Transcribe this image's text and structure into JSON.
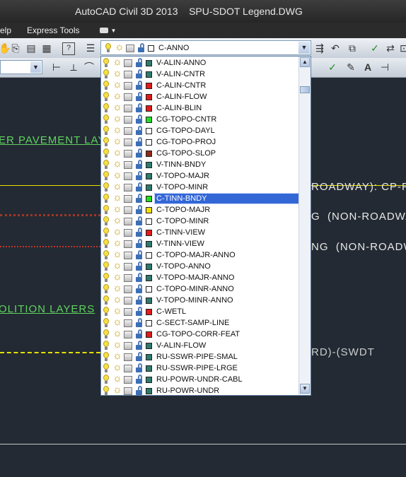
{
  "window": {
    "title": "AutoCAD Civil 3D 2013    SPU-SDOT Legend.DWG"
  },
  "menu": {
    "items": [
      "elp",
      "Express Tools"
    ]
  },
  "layer_combo": {
    "current_layer": "C-ANNO",
    "current_color": "#ffffff"
  },
  "drawing": {
    "texts": [
      {
        "text": "ER PAVEMENT LAY"
      },
      {
        "text": "ROADWAY): CP-PY"
      },
      {
        "text": "G  (NON-ROADWAY"
      },
      {
        "text": "NG  (NON-ROADW"
      },
      {
        "text": "OLITION LAYERS"
      },
      {
        "text": "RD)-(SWDT"
      }
    ]
  },
  "layers": [
    {
      "name": "V-ALIN-ANNO",
      "color": "#2e7a6e",
      "selected": false
    },
    {
      "name": "V-ALIN-CNTR",
      "color": "#2e7a6e",
      "selected": false
    },
    {
      "name": "C-ALIN-CNTR",
      "color": "#e01b1b",
      "selected": false
    },
    {
      "name": "C-ALIN-FLOW",
      "color": "#e01b1b",
      "selected": false
    },
    {
      "name": "C-ALIN-BLIN",
      "color": "#e01b1b",
      "selected": false
    },
    {
      "name": "CG-TOPO-CNTR",
      "color": "#22dd22",
      "selected": false
    },
    {
      "name": "CG-TOPO-DAYL",
      "color": "#ffffff",
      "selected": false
    },
    {
      "name": "CG-TOPO-PROJ",
      "color": "#ffffff",
      "selected": false
    },
    {
      "name": "CG-TOPO-SLOP",
      "color": "#8b2a1a",
      "selected": false
    },
    {
      "name": "V-TINN-BNDY",
      "color": "#2e7a6e",
      "selected": false
    },
    {
      "name": "V-TOPO-MAJR",
      "color": "#2e7a6e",
      "selected": false
    },
    {
      "name": "V-TOPO-MINR",
      "color": "#2e7a6e",
      "selected": false
    },
    {
      "name": "C-TINN-BNDY",
      "color": "#22dd22",
      "selected": true
    },
    {
      "name": "C-TOPO-MAJR",
      "color": "#f5e000",
      "selected": false
    },
    {
      "name": "C-TOPO-MINR",
      "color": "#ffffff",
      "selected": false
    },
    {
      "name": "C-TINN-VIEW",
      "color": "#e01b1b",
      "selected": false
    },
    {
      "name": "V-TINN-VIEW",
      "color": "#2e7a6e",
      "selected": false
    },
    {
      "name": "C-TOPO-MAJR-ANNO",
      "color": "#ffffff",
      "selected": false
    },
    {
      "name": "V-TOPO-ANNO",
      "color": "#2e7a6e",
      "selected": false
    },
    {
      "name": "V-TOPO-MAJR-ANNO",
      "color": "#2e7a6e",
      "selected": false
    },
    {
      "name": "C-TOPO-MINR-ANNO",
      "color": "#ffffff",
      "selected": false
    },
    {
      "name": "V-TOPO-MINR-ANNO",
      "color": "#2e7a6e",
      "selected": false
    },
    {
      "name": "C-WETL",
      "color": "#e01b1b",
      "selected": false
    },
    {
      "name": "C-SECT-SAMP-LINE",
      "color": "#ffffff",
      "selected": false
    },
    {
      "name": "CG-TOPO-CORR-FEAT",
      "color": "#e01b1b",
      "selected": false
    },
    {
      "name": "V-ALIN-FLOW",
      "color": "#2e7a6e",
      "selected": false
    },
    {
      "name": "RU-SSWR-PIPE-SMAL",
      "color": "#2e7a6e",
      "selected": false
    },
    {
      "name": "RU-SSWR-PIPE-LRGE",
      "color": "#2e7a6e",
      "selected": false
    },
    {
      "name": "RU-POWR-UNDR-CABL",
      "color": "#2e7a6e",
      "selected": false
    },
    {
      "name": "RU-POWR-UNDR",
      "color": "#2e7a6e",
      "selected": false
    }
  ]
}
